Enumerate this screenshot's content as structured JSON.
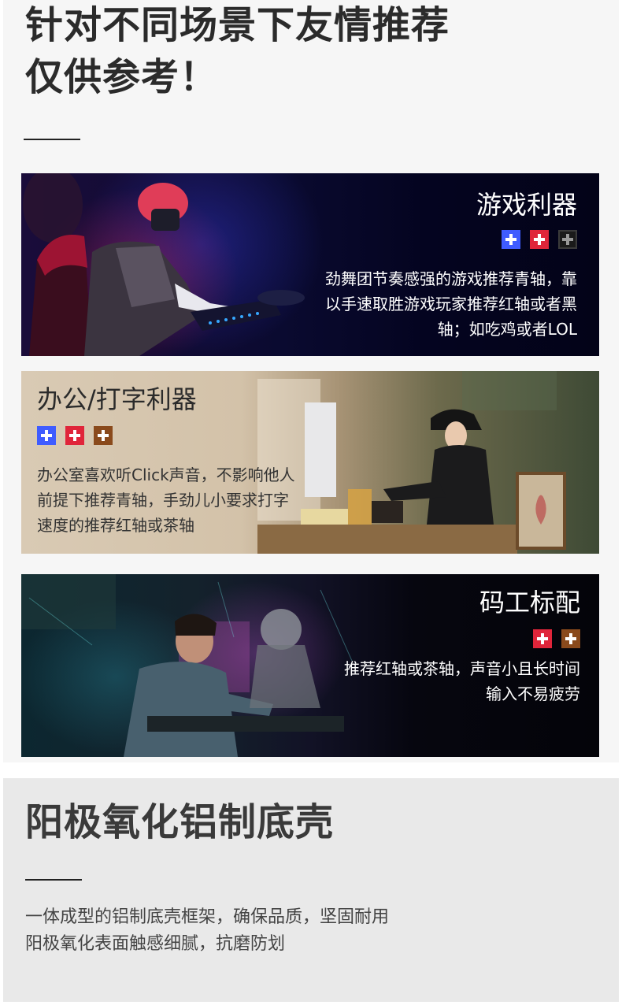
{
  "header": {
    "line1": "针对不同场景下友情推荐",
    "line2": "仅供参考！"
  },
  "colors": {
    "blue_switch": "#3f5cff",
    "red_switch": "#e0253a",
    "black_switch": "#2a2a2a",
    "brown_switch": "#8a4a1c"
  },
  "cards": [
    {
      "title": "游戏利器",
      "switches": [
        "blue-switch-icon",
        "red-switch-icon",
        "black-switch-icon"
      ],
      "desc_lines": [
        "劲舞团节奏感强的游戏推荐青轴，靠",
        "以手速取胜游戏玩家推荐红轴或者黑",
        "轴；如吃鸡或者LOL"
      ]
    },
    {
      "title": "办公/打字利器",
      "switches": [
        "blue-switch-icon",
        "red-switch-icon",
        "brown-switch-icon"
      ],
      "desc_lines": [
        "办公室喜欢听Click声音，不影响他人",
        "前提下推荐青轴，手劲儿小要求打字",
        "速度的推荐红轴或茶轴"
      ]
    },
    {
      "title": "码工标配",
      "switches": [
        "red-switch-icon",
        "brown-switch-icon"
      ],
      "desc_lines": [
        "推荐红轴或茶轴，声音小且长时间",
        "输入不易疲劳"
      ]
    }
  ],
  "bottom": {
    "title": "阳极氧化铝制底壳",
    "desc_lines": [
      "一体成型的铝制底壳框架，确保品质，坚固耐用",
      "阳极氧化表面触感细腻，抗磨防划"
    ]
  }
}
